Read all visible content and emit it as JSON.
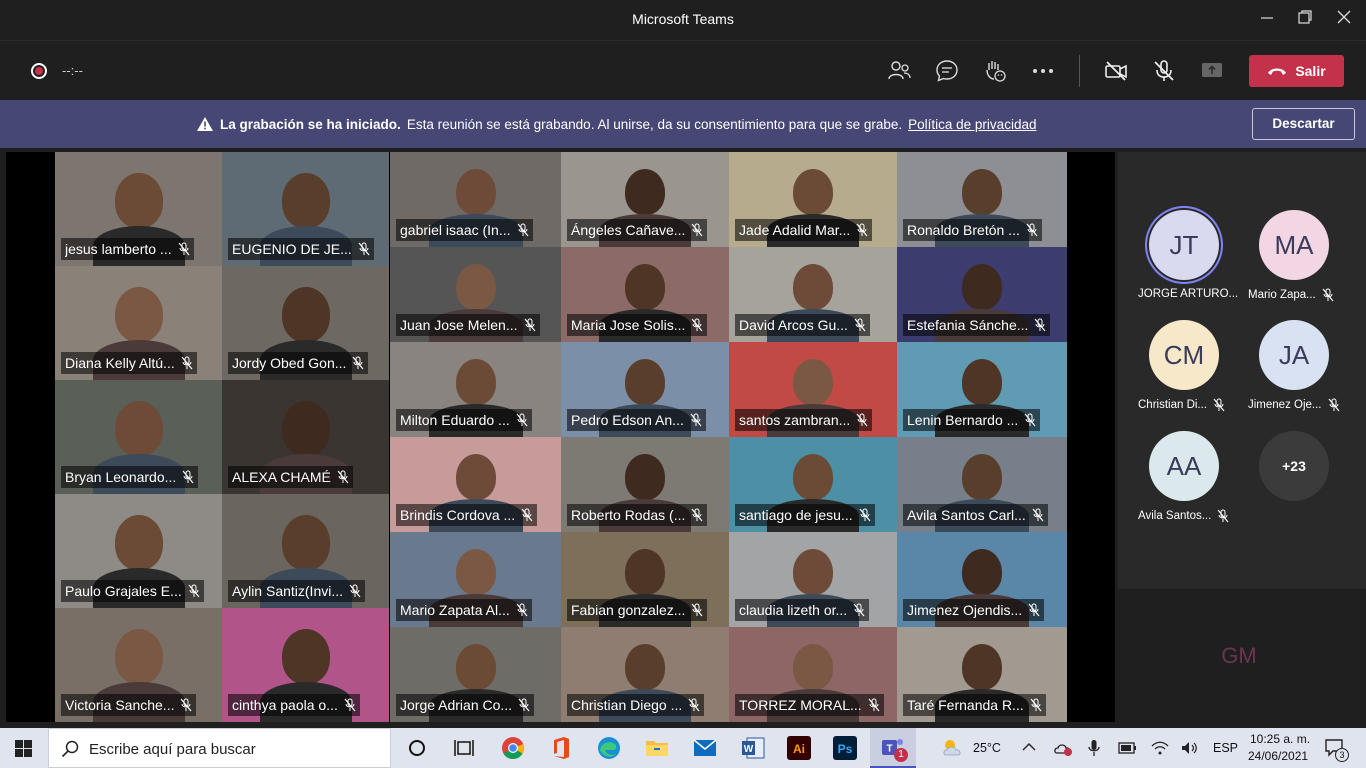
{
  "window": {
    "title": "Microsoft Teams"
  },
  "toolbar": {
    "timer": "--:--",
    "leave_label": "Salir"
  },
  "banner": {
    "title": "La grabación se ha iniciado.",
    "message": "Esta reunión se está grabando. Al unirse, da su consentimiento para que se grabe.",
    "link": "Política de privacidad",
    "dismiss_label": "Descartar"
  },
  "tiles": [
    "jesus lamberto ...",
    "EUGENIO DE JE...",
    "Diana Kelly Altú...",
    "Jordy Obed Gon...",
    "Bryan Leonardo...",
    "ALEXA CHAMÉ",
    "Paulo Grajales E...",
    "Aylin Santiz(Invi...",
    "Victoria Sanche...",
    "cinthya paola o...",
    "gabriel isaac  (In...",
    "Ángeles Cañave...",
    "Jade Adalid Mar...",
    "Ronaldo Bretón ...",
    "Juan Jose Melen...",
    "Maria Jose Solis...",
    "David Arcos Gu...",
    "Estefania Sánche...",
    "Milton Eduardo ...",
    "Pedro Edson An...",
    "santos zambran...",
    "Lenin Bernardo ...",
    "Brindis Cordova ...",
    "Roberto Rodas (...",
    "santiago de jesu...",
    "Avila Santos Carl...",
    "Mario Zapata Al...",
    "Fabian gonzalez...",
    "claudia lizeth or...",
    "Jimenez Ojendis...",
    "Jorge Adrian Co...",
    "Christian Diego ...",
    "TORREZ MORAL...",
    "Taré Fernanda R..."
  ],
  "roster": [
    {
      "initials": "JT",
      "name": "JORGE ARTURO...",
      "muted": false,
      "color": "#d9d9f0"
    },
    {
      "initials": "MA",
      "name": "Mario Zapa...",
      "muted": true,
      "color": "#f3d6e3"
    },
    {
      "initials": "CM",
      "name": "Christian Di...",
      "muted": true,
      "color": "#f6e8c8"
    },
    {
      "initials": "JA",
      "name": "Jimenez Oje...",
      "muted": true,
      "color": "#d8e2f2"
    },
    {
      "initials": "AA",
      "name": "Avila Santos...",
      "muted": true,
      "color": "#dce9ec"
    },
    {
      "initials": "+23",
      "name": "",
      "muted": false,
      "color": "#3b3b3b"
    }
  ],
  "self_avatar": {
    "initials": "GM",
    "color": "#f3d6e3"
  },
  "taskbar": {
    "search_placeholder": "Escribe aquí para buscar",
    "temperature": "25°C",
    "language": "ESP",
    "time": "10:25 a. m.",
    "date": "24/06/2021",
    "notification_count": "3",
    "teams_badge": "1"
  }
}
